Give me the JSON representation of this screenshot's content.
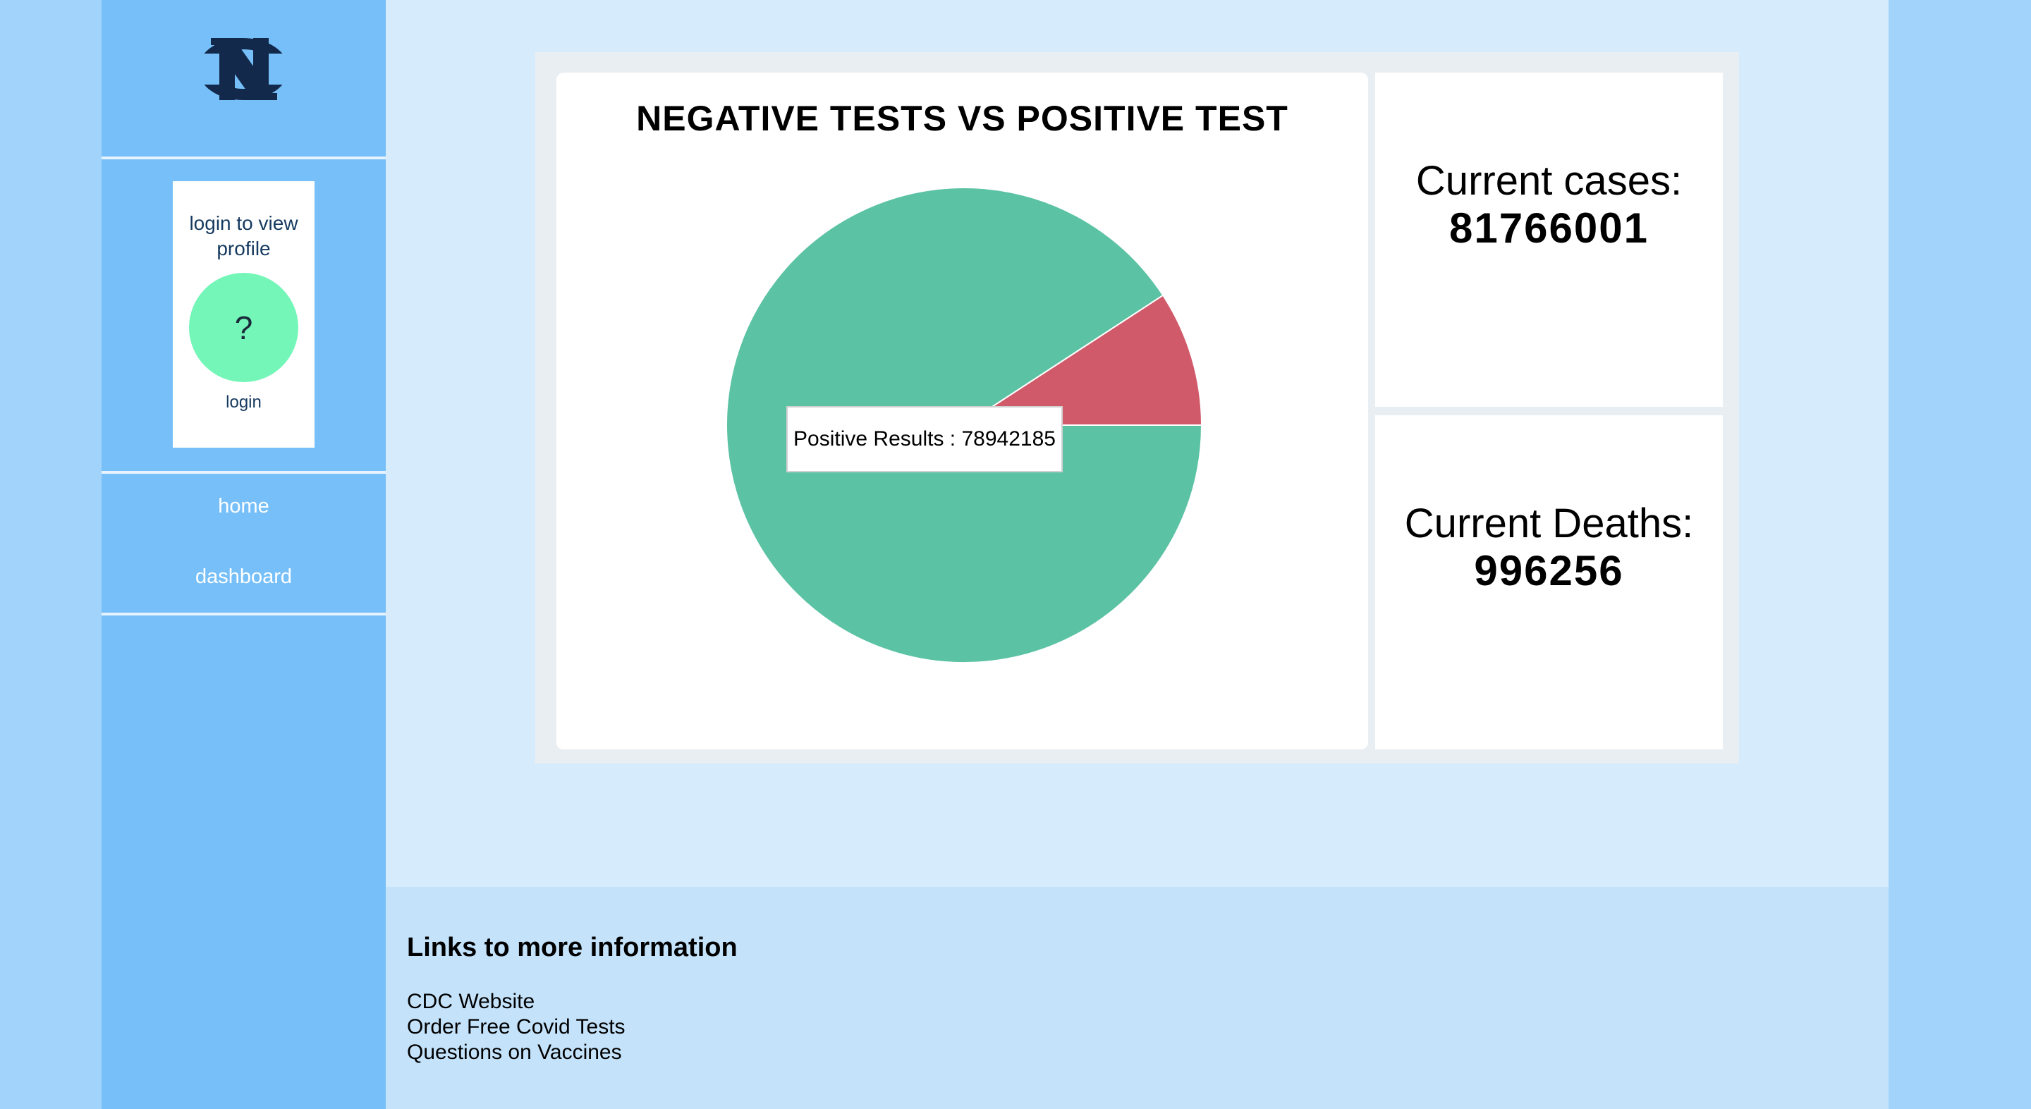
{
  "sidebar": {
    "logo_alt": "NC",
    "profile_prompt": "login to view profile",
    "avatar_text": "?",
    "login_label": "login",
    "nav": [
      {
        "label": "home"
      },
      {
        "label": "dashboard"
      }
    ]
  },
  "chart_data": {
    "type": "pie",
    "title": "NEGATIVE TESTS VS POSITIVE TEST",
    "slices": [
      {
        "name": "Positive Results",
        "value": 78942185,
        "color": "#5bc2a4"
      },
      {
        "name": "",
        "value": 8000000,
        "color": "#d05a6a"
      }
    ],
    "tooltip": "Positive Results : 78942185"
  },
  "stats": {
    "cases_label": "Current cases:",
    "cases_value": "81766001",
    "deaths_label": "Current Deaths:",
    "deaths_value": "996256"
  },
  "footer": {
    "heading": "Links to more information",
    "links": [
      {
        "label": "CDC Website"
      },
      {
        "label": "Order Free Covid Tests"
      },
      {
        "label": "Questions on Vaccines"
      }
    ]
  },
  "colors": {
    "page_bg": "#a2d3fb",
    "sidebar_bg": "#76bff8",
    "main_bg": "#d6ebfc",
    "footer_bg": "#c4e3fb",
    "avatar": "#74f6b8"
  }
}
